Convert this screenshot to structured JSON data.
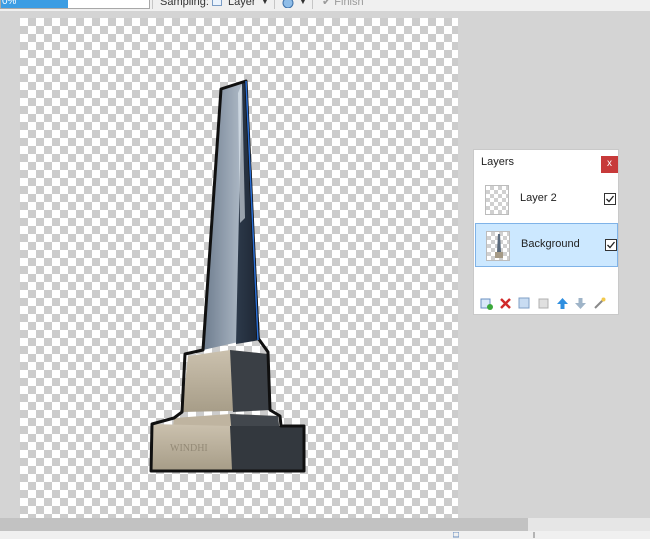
{
  "toolbar": {
    "tolerance_value": "0%",
    "tolerance_level": 0.45,
    "sampling_label": "Sampling:",
    "sampling_value": "Layer",
    "finish_label": "Finish"
  },
  "layers_panel": {
    "title": "Layers",
    "close_label": "x",
    "layers": [
      {
        "name": "Layer 2",
        "visible": true,
        "selected": false
      },
      {
        "name": "Background",
        "visible": true,
        "selected": true
      }
    ],
    "tools": [
      "add-layer-icon",
      "delete-layer-icon",
      "duplicate-layer-icon",
      "merge-layer-down-icon",
      "move-layer-up-icon",
      "move-layer-down-icon",
      "layer-properties-icon"
    ]
  },
  "colors": {
    "accent": "#3c9de3",
    "selection": "#cce8ff",
    "close_button": "#c73a3a"
  }
}
